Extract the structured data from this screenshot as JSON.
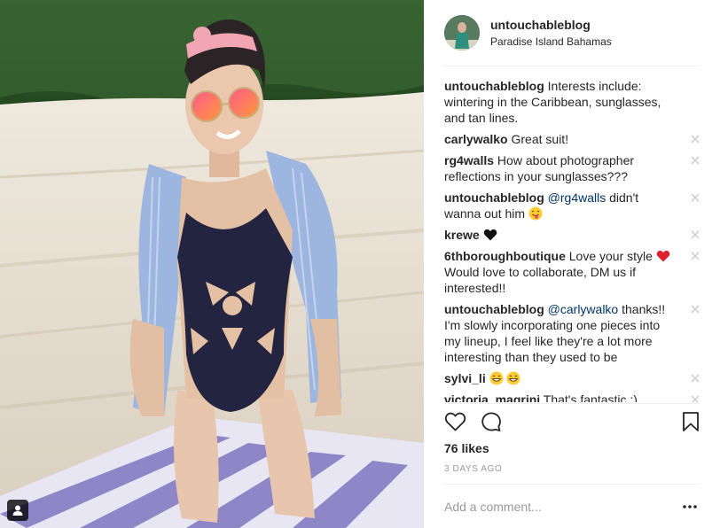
{
  "post": {
    "username": "untouchableblog",
    "location": "Paradise Island Bahamas",
    "likes": "76 likes",
    "time_ago": "3 DAYS AGO",
    "add_comment_placeholder": "Add a comment..."
  },
  "caption": {
    "user": "untouchableblog",
    "text": " Interests include: wintering in the Caribbean, sunglasses, and tan lines."
  },
  "comments": [
    {
      "user": "carlywalko",
      "text": " Great suit!"
    },
    {
      "user": "rg4walls",
      "text": " How about photographer reflections in your sunglasses???"
    },
    {
      "user": "untouchableblog",
      "mention": "@rg4walls",
      "text": " didn't wanna out him ",
      "emoji": "tongue-face-emoji"
    },
    {
      "user": "krewe",
      "text": " ",
      "emoji": "black-heart-emoji"
    },
    {
      "user": "6thboroughboutique",
      "text": " Love your style ",
      "emoji": "red-heart-emoji",
      "text2": " Would love to collaborate, DM us if interested!!"
    },
    {
      "user": "untouchableblog",
      "mention": "@carlywalko",
      "text": " thanks!! I'm slowly incorporating one pieces into my lineup, I feel like they're a lot more interesting than they used to be"
    },
    {
      "user": "sylvi_li",
      "text": " ",
      "emoji": "grinning-face-emoji"
    },
    {
      "user": "victoria_magrini",
      "text": " That's fantastic :)"
    }
  ],
  "icons": {
    "like": "heart-outline-icon",
    "comment": "speech-bubble-icon",
    "save": "bookmark-icon",
    "more": "ellipsis-icon",
    "tag": "person-tag-icon",
    "remove": "close-icon"
  }
}
